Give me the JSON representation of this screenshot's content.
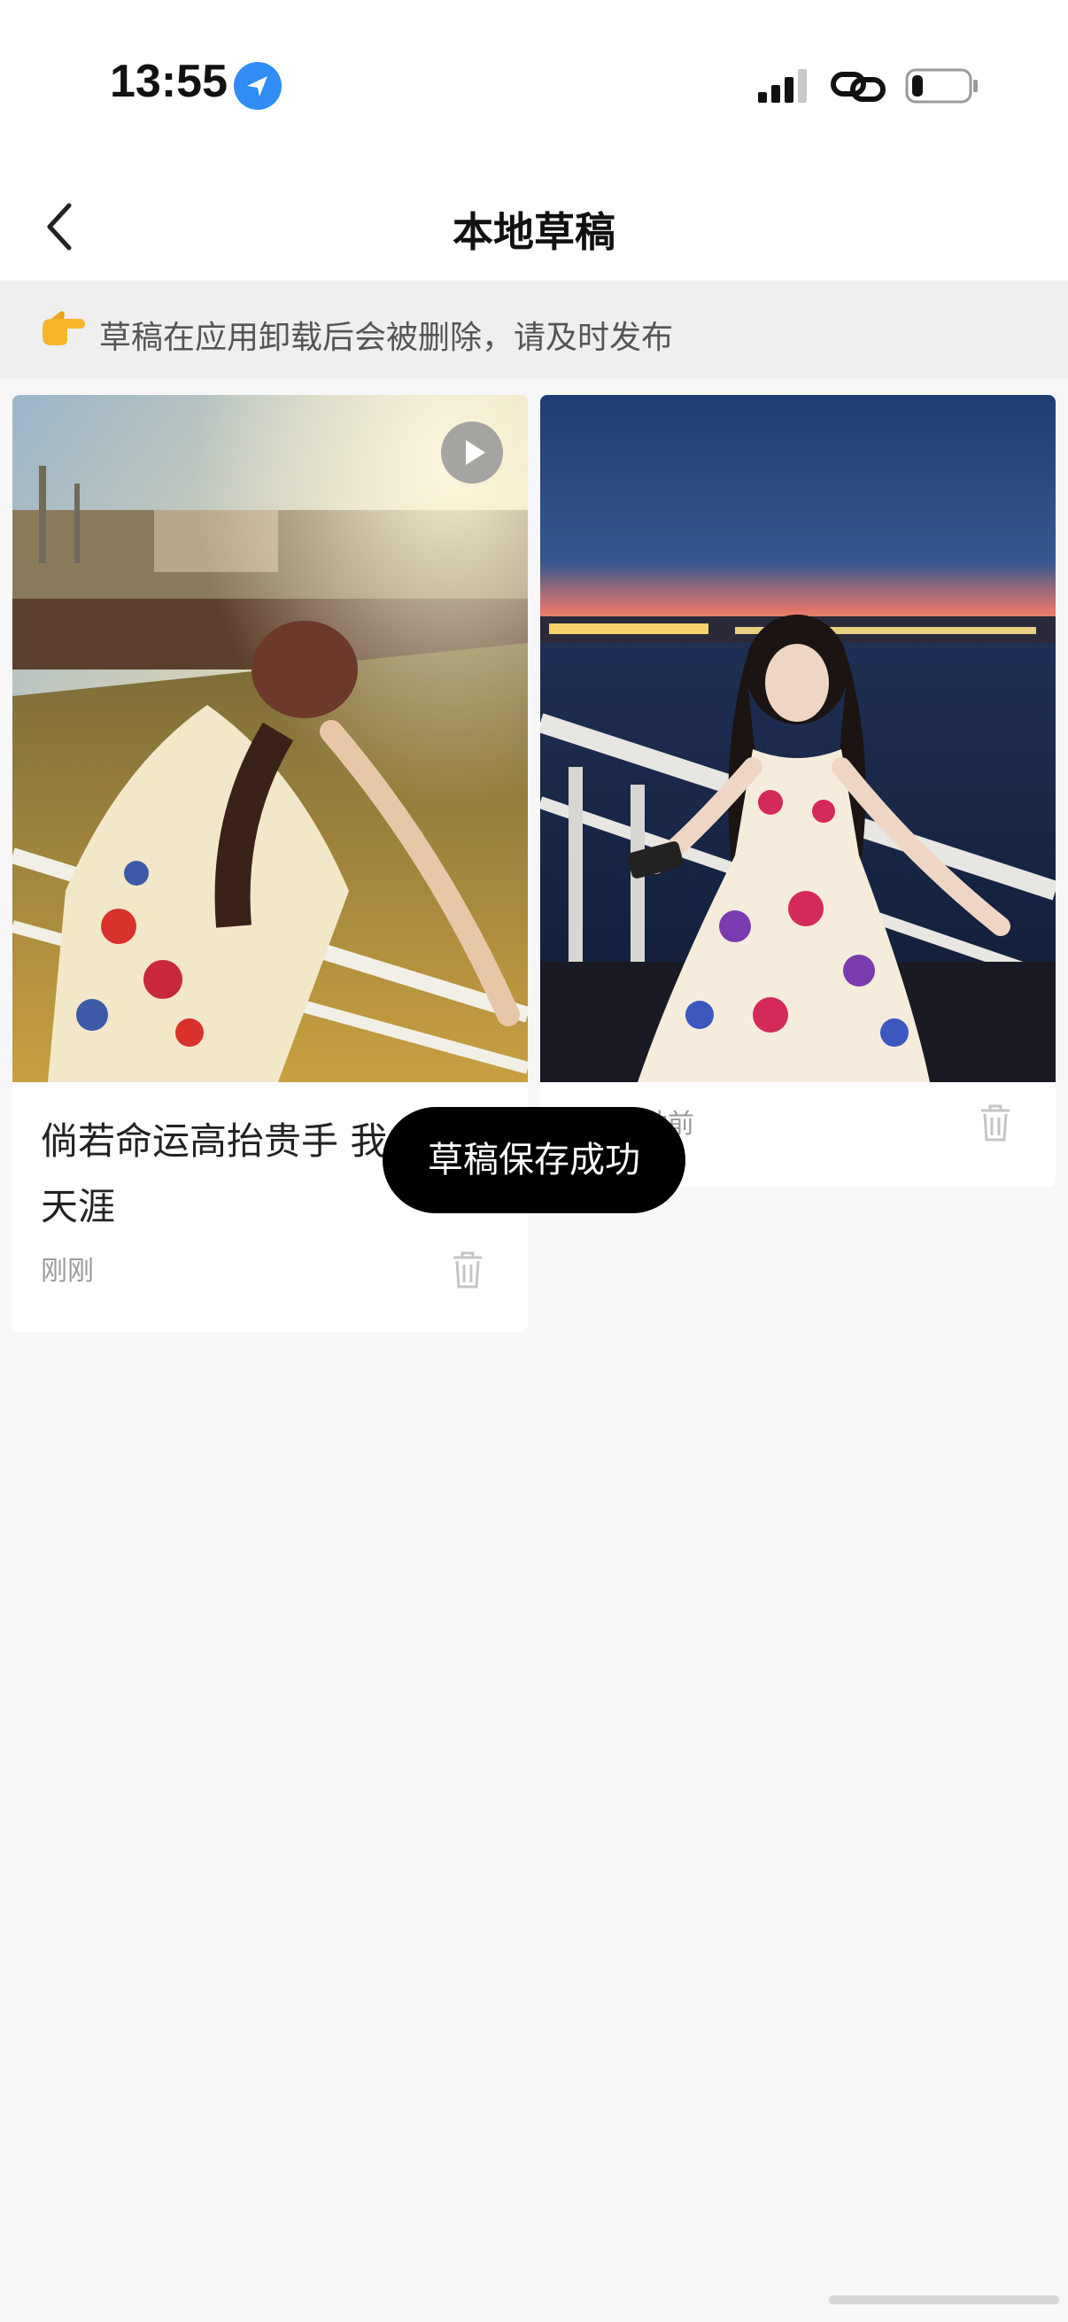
{
  "status_bar": {
    "time": "13:55",
    "icons": [
      "location-arrow-icon",
      "cellular-signal-icon",
      "personal-hotspot-link-icon",
      "battery-low-icon"
    ]
  },
  "header": {
    "title": "本地草稿",
    "back_icon": "chevron-left-icon"
  },
  "notice": {
    "emoji_icon": "pointing-hand-icon",
    "text": "草稿在应用卸载后会被删除，请及时发布"
  },
  "drafts": [
    {
      "title": "倘若命运高抬贵手 我会浪迹天涯",
      "time": "刚刚",
      "has_video": true,
      "thumbnail": "woman-floral-dress-ferry-sunset-photo",
      "delete_icon": "trash-icon"
    },
    {
      "title": "",
      "time": "分钟前",
      "has_video": false,
      "thumbnail": "woman-floral-dress-ferry-dusk-photo",
      "delete_icon": "trash-icon"
    }
  ],
  "toast": {
    "text": "草稿保存成功"
  },
  "colors": {
    "background": "#f7f7f7",
    "card": "#ffffff",
    "notice_bg": "#efefef",
    "toast_bg": "#000000",
    "location_blue": "#2f8df5"
  }
}
